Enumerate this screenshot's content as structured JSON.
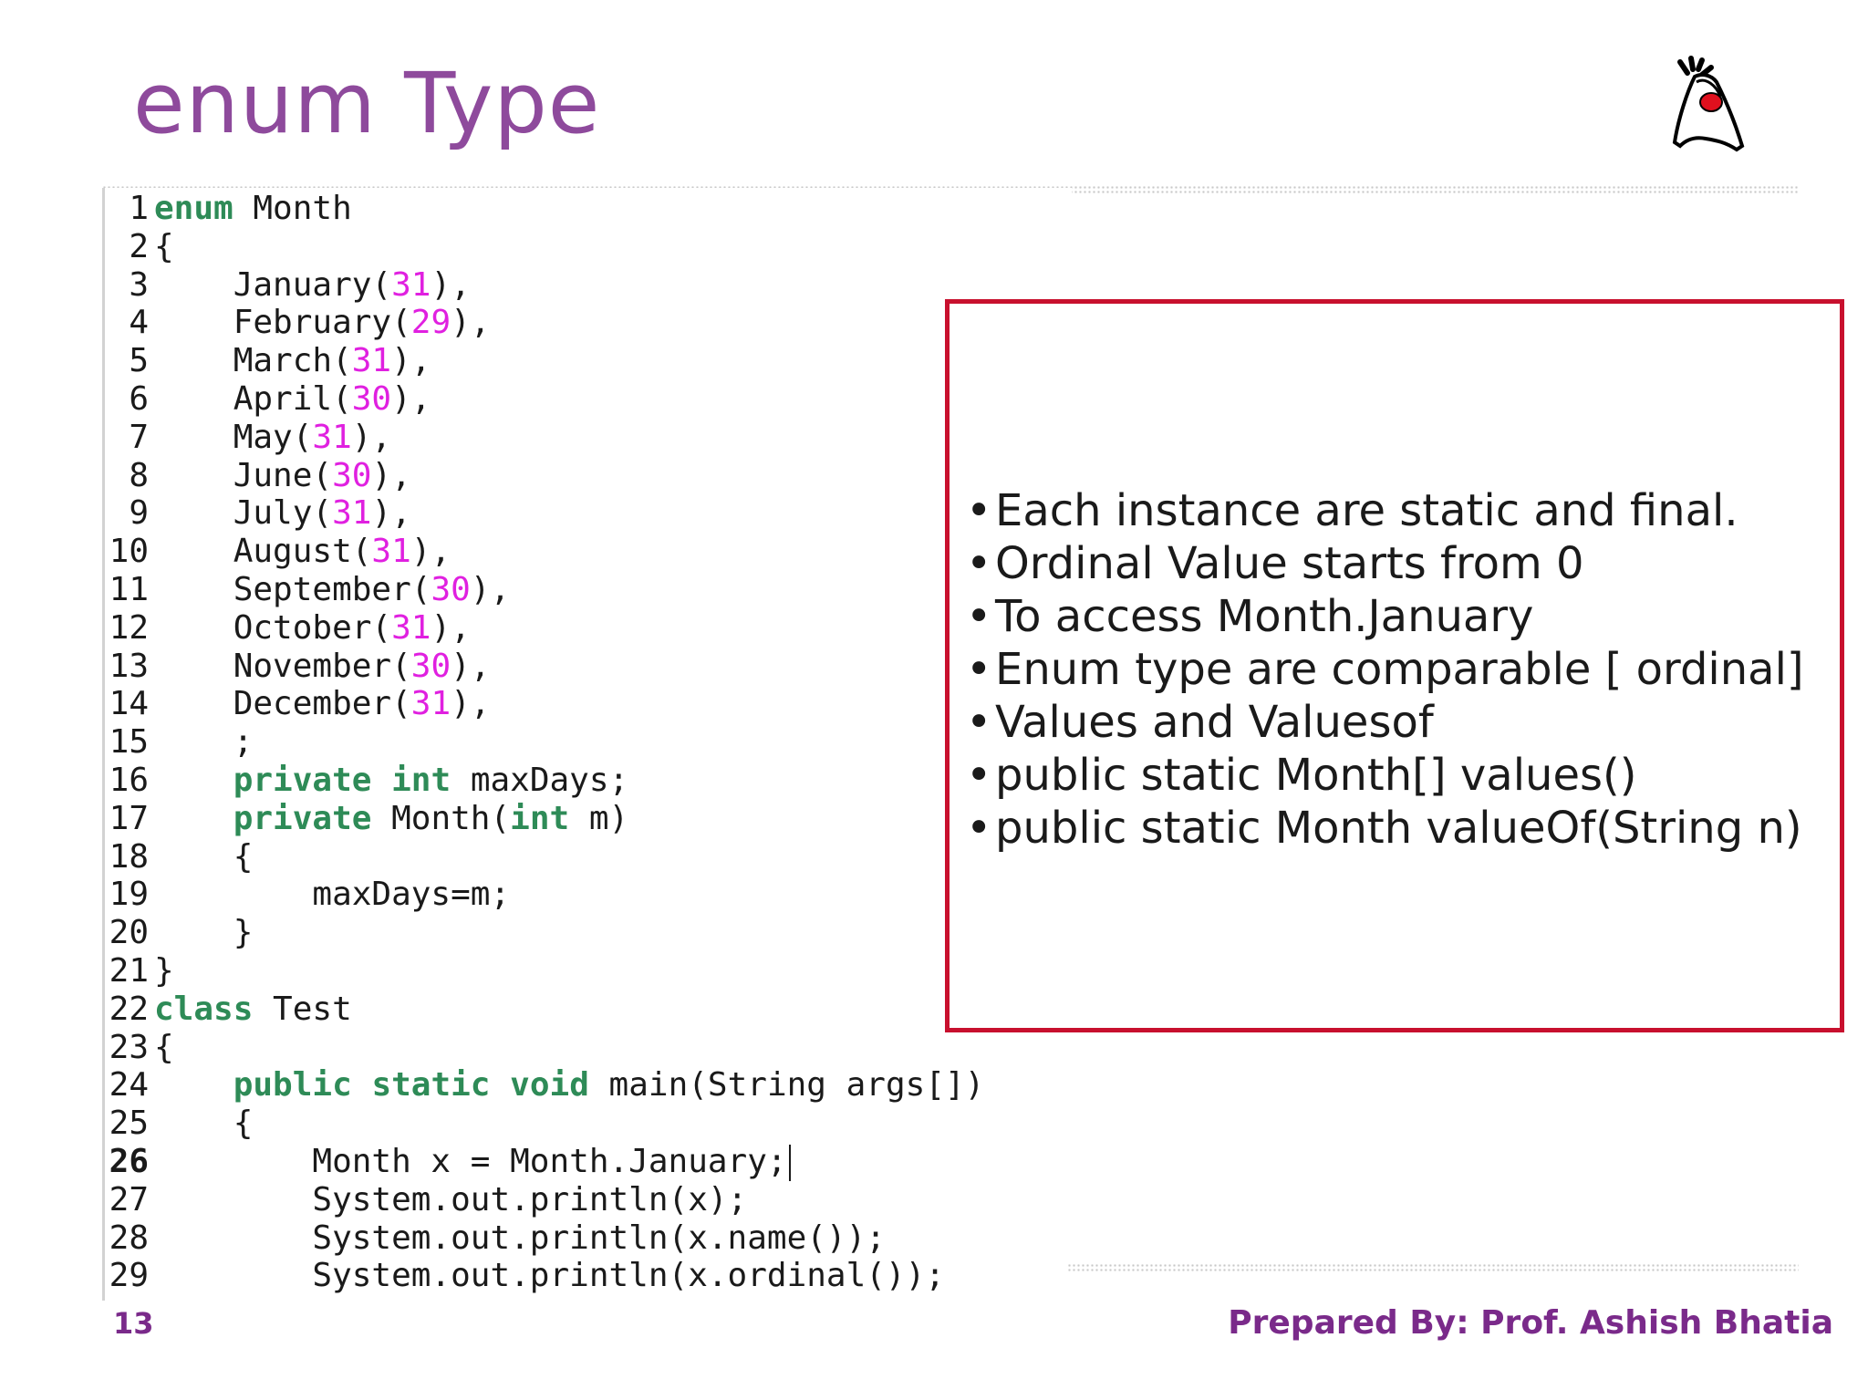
{
  "slide": {
    "title": "enum Type",
    "page_number": "13",
    "credit": "Prepared By: Prof. Ashish Bhatia",
    "logo_icon": "java-duke-icon"
  },
  "code": {
    "lines": [
      {
        "n": "1",
        "tokens": [
          [
            "kw",
            "enum"
          ],
          [
            "t",
            " Month"
          ]
        ]
      },
      {
        "n": "2",
        "tokens": [
          [
            "t",
            "{"
          ]
        ]
      },
      {
        "n": "3",
        "tokens": [
          [
            "t",
            "    January("
          ],
          [
            "num",
            "31"
          ],
          [
            "t",
            "),"
          ]
        ]
      },
      {
        "n": "4",
        "tokens": [
          [
            "t",
            "    February("
          ],
          [
            "num",
            "29"
          ],
          [
            "t",
            "),"
          ]
        ]
      },
      {
        "n": "5",
        "tokens": [
          [
            "t",
            "    March("
          ],
          [
            "num",
            "31"
          ],
          [
            "t",
            "),"
          ]
        ]
      },
      {
        "n": "6",
        "tokens": [
          [
            "t",
            "    April("
          ],
          [
            "num",
            "30"
          ],
          [
            "t",
            "),"
          ]
        ]
      },
      {
        "n": "7",
        "tokens": [
          [
            "t",
            "    May("
          ],
          [
            "num",
            "31"
          ],
          [
            "t",
            "),"
          ]
        ]
      },
      {
        "n": "8",
        "tokens": [
          [
            "t",
            "    June("
          ],
          [
            "num",
            "30"
          ],
          [
            "t",
            "),"
          ]
        ]
      },
      {
        "n": "9",
        "tokens": [
          [
            "t",
            "    July("
          ],
          [
            "num",
            "31"
          ],
          [
            "t",
            "),"
          ]
        ]
      },
      {
        "n": "10",
        "tokens": [
          [
            "t",
            "    August("
          ],
          [
            "num",
            "31"
          ],
          [
            "t",
            "),"
          ]
        ]
      },
      {
        "n": "11",
        "tokens": [
          [
            "t",
            "    September("
          ],
          [
            "num",
            "30"
          ],
          [
            "t",
            "),"
          ]
        ]
      },
      {
        "n": "12",
        "tokens": [
          [
            "t",
            "    October("
          ],
          [
            "num",
            "31"
          ],
          [
            "t",
            "),"
          ]
        ]
      },
      {
        "n": "13",
        "tokens": [
          [
            "t",
            "    November("
          ],
          [
            "num",
            "30"
          ],
          [
            "t",
            "),"
          ]
        ]
      },
      {
        "n": "14",
        "tokens": [
          [
            "t",
            "    December("
          ],
          [
            "num",
            "31"
          ],
          [
            "t",
            "),"
          ]
        ]
      },
      {
        "n": "15",
        "tokens": [
          [
            "t",
            "    ;"
          ]
        ]
      },
      {
        "n": "16",
        "tokens": [
          [
            "t",
            "    "
          ],
          [
            "kw",
            "private"
          ],
          [
            "t",
            " "
          ],
          [
            "kw",
            "int"
          ],
          [
            "t",
            " maxDays;"
          ]
        ]
      },
      {
        "n": "17",
        "tokens": [
          [
            "t",
            "    "
          ],
          [
            "kw",
            "private"
          ],
          [
            "t",
            " Month("
          ],
          [
            "kw",
            "int"
          ],
          [
            "t",
            " m)"
          ]
        ]
      },
      {
        "n": "18",
        "tokens": [
          [
            "t",
            "    {"
          ]
        ]
      },
      {
        "n": "19",
        "tokens": [
          [
            "t",
            "        maxDays=m;"
          ]
        ]
      },
      {
        "n": "20",
        "tokens": [
          [
            "t",
            "    }"
          ]
        ]
      },
      {
        "n": "21",
        "tokens": [
          [
            "t",
            "}"
          ]
        ]
      },
      {
        "n": "22",
        "tokens": [
          [
            "kw",
            "class"
          ],
          [
            "t",
            " Test"
          ]
        ]
      },
      {
        "n": "23",
        "tokens": [
          [
            "t",
            "{"
          ]
        ]
      },
      {
        "n": "24",
        "tokens": [
          [
            "t",
            "    "
          ],
          [
            "kw",
            "public"
          ],
          [
            "t",
            " "
          ],
          [
            "kw",
            "static"
          ],
          [
            "t",
            " "
          ],
          [
            "kw",
            "void"
          ],
          [
            "t",
            " main(String args[])"
          ]
        ]
      },
      {
        "n": "25",
        "tokens": [
          [
            "t",
            "    {"
          ]
        ]
      },
      {
        "n": "26",
        "tokens": [
          [
            "t",
            "        Month x = Month.January;"
          ]
        ],
        "active": true
      },
      {
        "n": "27",
        "tokens": [
          [
            "t",
            "        System.out.println(x);"
          ]
        ]
      },
      {
        "n": "28",
        "tokens": [
          [
            "t",
            "        System.out.println(x.name());"
          ]
        ]
      },
      {
        "n": "29",
        "tokens": [
          [
            "t",
            "        System.out.println(x.ordinal());"
          ]
        ]
      }
    ]
  },
  "notes": {
    "bullet_glyph": "•",
    "items": [
      "Each instance are static and final.",
      "Ordinal Value starts from 0",
      "To access Month.January",
      "Enum type are comparable [ ordinal]",
      "Values and Valuesof",
      "public static Month[] values()",
      "public static Month valueOf(String n)"
    ]
  },
  "colors": {
    "title": "#8e4a9c",
    "keyword": "#2e8b57",
    "number": "#e020e0",
    "box_border": "#c8102e",
    "footer": "#7a2a8a"
  }
}
